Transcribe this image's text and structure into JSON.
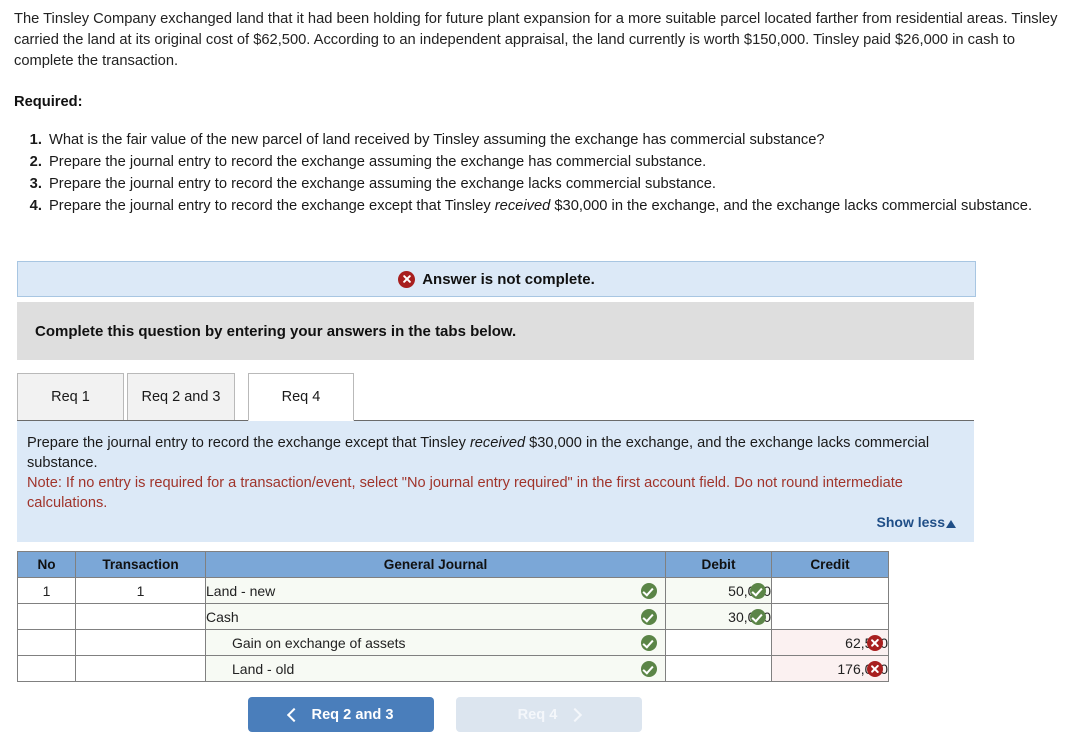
{
  "problem": {
    "statement": "The Tinsley Company exchanged land that it had been holding for future plant expansion for a more suitable parcel located farther from residential areas. Tinsley carried the land at its original cost of $62,500. According to an independent appraisal, the land currently is worth $150,000. Tinsley paid $26,000 in cash to complete the transaction."
  },
  "required": {
    "label": "Required:",
    "items": [
      "What is the fair value of the new parcel of land received by Tinsley assuming the exchange has commercial substance?",
      "Prepare the journal entry to record the exchange assuming the exchange has commercial substance.",
      "Prepare the journal entry to record the exchange assuming the exchange lacks commercial substance.",
      "Prepare the journal entry to record the exchange except that Tinsley received $30,000 in the exchange, and the exchange lacks commercial substance."
    ],
    "item4_prefix": "Prepare the journal entry to record the exchange except that Tinsley ",
    "item4_italic": "received",
    "item4_suffix": " $30,000 in the exchange, and the exchange lacks commercial substance."
  },
  "alert": {
    "icon": "error-x-circle-icon",
    "text": "Answer is not complete.",
    "background": "#dce9f7",
    "icon_color": "#a81f1f"
  },
  "instruction_strip": {
    "text": "Complete this question by entering your answers in the tabs below.",
    "background": "#dedede"
  },
  "tabs": {
    "items": [
      {
        "label": "Req 1",
        "active": false
      },
      {
        "label": "Req 2 and 3",
        "active": false
      },
      {
        "label": "Req 4",
        "active": true
      }
    ]
  },
  "req_panel": {
    "prompt_prefix": "Prepare the journal entry to record the exchange except that Tinsley ",
    "prompt_italic": "received",
    "prompt_suffix": " $30,000 in the exchange, and the exchange lacks commercial substance.",
    "note": "Note: If no entry is required for a transaction/event, select \"No journal entry required\" in the first account field. Do not round intermediate calculations.",
    "note_color": "#a0342b",
    "show_less_label": "Show less",
    "show_less_icon": "triangle-up-icon",
    "background": "#dce9f7"
  },
  "journal_table": {
    "header_background": "#7ba7d7",
    "columns": [
      "No",
      "Transaction",
      "General Journal",
      "Debit",
      "Credit"
    ],
    "rows": [
      {
        "no": "1",
        "transaction": "1",
        "account": "Land - new",
        "indent": false,
        "account_mark": "check",
        "debit": "50,000",
        "debit_mark": "check",
        "credit": "",
        "credit_mark": ""
      },
      {
        "no": "",
        "transaction": "",
        "account": "Cash",
        "indent": false,
        "account_mark": "check",
        "debit": "30,000",
        "debit_mark": "check",
        "credit": "",
        "credit_mark": ""
      },
      {
        "no": "",
        "transaction": "",
        "account": "Gain on exchange of assets",
        "indent": true,
        "account_mark": "check",
        "debit": "",
        "debit_mark": "",
        "credit": "62,500",
        "credit_mark": "cross"
      },
      {
        "no": "",
        "transaction": "",
        "account": "Land - old",
        "indent": true,
        "account_mark": "check",
        "debit": "",
        "debit_mark": "",
        "credit": "176,000",
        "credit_mark": "cross"
      }
    ],
    "correct_color": "#5b8547",
    "incorrect_color": "#a81f1f"
  },
  "nav": {
    "prev_label": "Req 2 and 3",
    "prev_icon": "chevron-left-icon",
    "next_label": "Req 4",
    "next_icon": "chevron-right-icon",
    "prev_color": "#4a7ebb",
    "next_disabled": true
  }
}
